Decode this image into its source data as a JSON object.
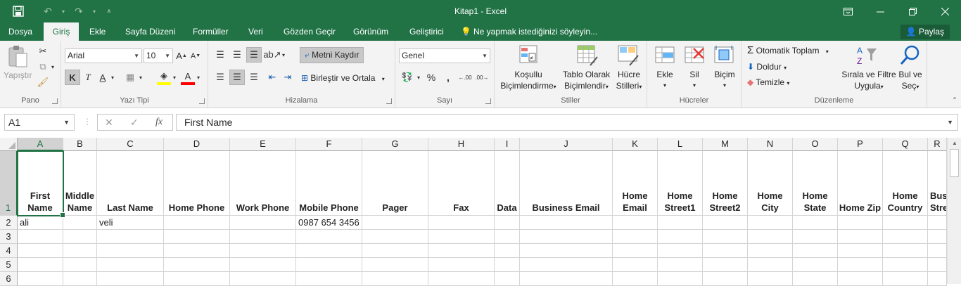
{
  "window": {
    "title": "Kitap1 - Excel"
  },
  "tabs": [
    "Dosya",
    "Giriş",
    "Ekle",
    "Sayfa Düzeni",
    "Formüller",
    "Veri",
    "Gözden Geçir",
    "Görünüm",
    "Geliştirici"
  ],
  "active_tab": "Giriş",
  "tell_me": "Ne yapmak istediğinizi söyleyin...",
  "share": "Paylaş",
  "ribbon": {
    "clipboard": {
      "label": "Pano",
      "paste": "Yapıştır"
    },
    "font": {
      "label": "Yazı Tipi",
      "name": "Arial",
      "size": "10",
      "bold": "K",
      "italic": "T",
      "underline": "A"
    },
    "alignment": {
      "label": "Hizalama",
      "wrap": "Metni Kaydır",
      "merge": "Birleştir ve Ortala"
    },
    "number": {
      "label": "Sayı",
      "format": "Genel",
      "percent": "%"
    },
    "styles": {
      "label": "Stiller",
      "cond1": "Koşullu",
      "cond2": "Biçimlendirme",
      "table1": "Tablo Olarak",
      "table2": "Biçimlendir",
      "cell1": "Hücre",
      "cell2": "Stilleri"
    },
    "cells": {
      "label": "Hücreler",
      "insert": "Ekle",
      "delete": "Sil",
      "format": "Biçim"
    },
    "editing": {
      "label": "Düzenleme",
      "autosum": "Otomatik Toplam",
      "fill": "Doldur",
      "clear": "Temizle",
      "sort1": "Sırala ve Filtre",
      "sort2": "Uygula",
      "find1": "Bul ve",
      "find2": "Seç"
    }
  },
  "formula_bar": {
    "name_box": "A1",
    "content": "First Name"
  },
  "sheet": {
    "columns": [
      "A",
      "B",
      "C",
      "D",
      "E",
      "F",
      "G",
      "H",
      "I",
      "J",
      "K",
      "L",
      "M",
      "N",
      "O",
      "P",
      "Q",
      "R"
    ],
    "rows": [
      "1",
      "2",
      "3",
      "4",
      "5",
      "6"
    ],
    "headers": [
      "First Name",
      "Middle Name",
      "Last Name",
      "Home Phone",
      "Work Phone",
      "Mobile Phone",
      "Pager",
      "Fax",
      "Data",
      "Business Email",
      "Home Email",
      "Home Street1",
      "Home Street2",
      "Home City",
      "Home State",
      "Home Zip",
      "Home Country",
      "Business Street"
    ],
    "row2": [
      "ali",
      "",
      "veli",
      "",
      "",
      "0987 654 3456",
      "",
      "",
      "",
      "",
      "",
      "",
      "",
      "",
      "",
      "",
      "",
      ""
    ]
  }
}
